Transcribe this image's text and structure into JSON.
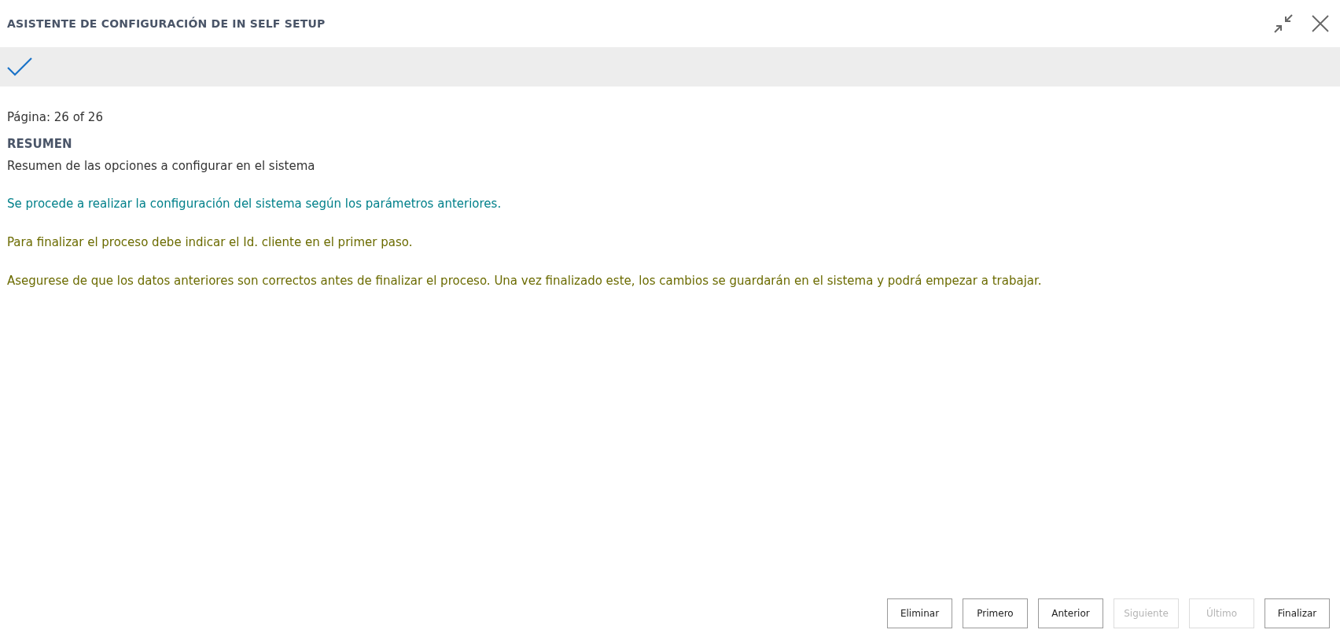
{
  "window": {
    "title": "ASISTENTE DE CONFIGURACIÓN DE IN SELF SETUP"
  },
  "page_indicator": "Página: 26 of 26",
  "section": {
    "heading": "RESUMEN",
    "description": "Resumen de las opciones a configurar en el sistema"
  },
  "messages": [
    {
      "text": "Se procede a realizar la configuración del sistema según los parámetros anteriores.",
      "color": "#00808a"
    },
    {
      "text": "Para finalizar el proceso debe indicar el Id. cliente en el primer paso.",
      "color": "#6b6b00"
    },
    {
      "text": "Asegurese de que los datos anteriores son correctos antes de finalizar el proceso. Una vez finalizado este, los cambios se guardarán en el sistema y podrá empezar a trabajar.",
      "color": "#6b6b00"
    }
  ],
  "buttons": [
    {
      "label": "Eliminar",
      "disabled": false
    },
    {
      "label": "Primero",
      "disabled": false
    },
    {
      "label": "Anterior",
      "disabled": false
    },
    {
      "label": "Siguiente",
      "disabled": true
    },
    {
      "label": "Último",
      "disabled": true
    },
    {
      "label": "Finalizar",
      "disabled": false
    }
  ]
}
